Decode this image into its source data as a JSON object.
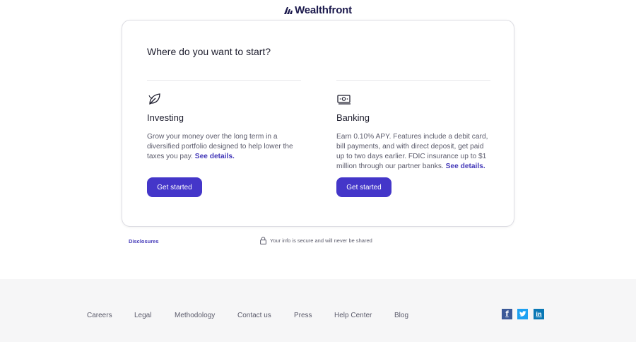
{
  "header": {
    "logo_text": "Wealthfront"
  },
  "card": {
    "title": "Where do you want to start?",
    "options": [
      {
        "icon": "leaf-icon",
        "title": "Investing",
        "description": "Grow your money over the long term in a diversified portfolio designed to help lower the taxes you pay.",
        "details_link": "See details.",
        "cta_label": "Get started"
      },
      {
        "icon": "cash-icon",
        "title": "Banking",
        "description": "Earn 0.10% APY. Features include a debit card, bill payments, and with direct deposit, get paid up to two days earlier. FDIC insurance up to $1 million through our partner banks.",
        "details_link": "See details.",
        "cta_label": "Get started"
      }
    ]
  },
  "below_card": {
    "disclosures_link": "Disclosures",
    "secure_text": "Your info is secure and will never be shared",
    "secure_icon": "lock-icon"
  },
  "footer": {
    "links": [
      "Careers",
      "Legal",
      "Methodology",
      "Contact us",
      "Press",
      "Help Center",
      "Blog"
    ],
    "social": [
      {
        "icon": "facebook-icon",
        "glyph": "f"
      },
      {
        "icon": "twitter-icon",
        "glyph": "t"
      },
      {
        "icon": "linkedin-icon",
        "glyph": "in"
      }
    ]
  },
  "colors": {
    "brand_purple": "#4436c9",
    "link_purple": "#4338b8",
    "logo_navy": "#1c1a4d",
    "footer_bg": "#f6f6f7"
  }
}
